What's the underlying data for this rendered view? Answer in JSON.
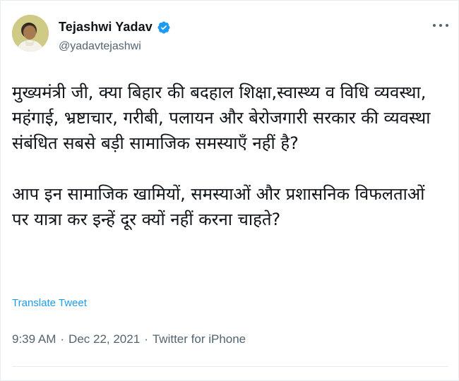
{
  "author": {
    "display_name": "Tejashwi Yadav",
    "handle": "@yadavtejashwi",
    "verified_icon": "verified-badge-icon",
    "avatar_icon": "avatar"
  },
  "tweet": {
    "paragraph1": "मुख्यमंत्री जी, क्या बिहार की बदहाल शिक्षा,स्वास्थ्य व विधि व्यवस्था, महंगाई, भ्रष्टाचार, गरीबी, पलायन और बेरोजगारी सरकार की व्यवस्था संबंधित सबसे बड़ी सामाजिक समस्याएँ नहीं है?",
    "paragraph2": "आप इन सामाजिक खामियों, समस्याओं और प्रशासनिक विफलताओं पर यात्रा कर इन्हें दूर क्यों नहीं करना चाहते?",
    "translate_label": "Translate Tweet"
  },
  "meta": {
    "time": "9:39 AM",
    "sep1": "·",
    "date": "Dec 22, 2021",
    "sep2": "·",
    "source": "Twitter for iPhone"
  },
  "colors": {
    "link": "#1d9bf0",
    "muted": "#536471",
    "text": "#0f1419",
    "divider": "#e6ecf0"
  }
}
